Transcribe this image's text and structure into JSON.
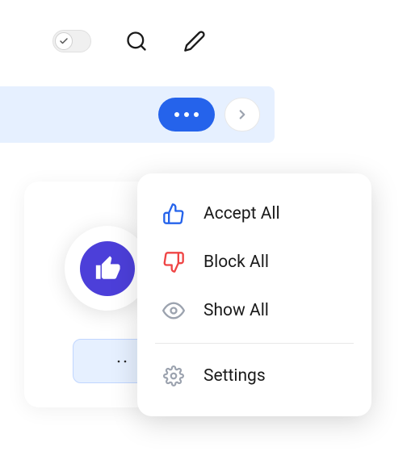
{
  "toolbar": {
    "toggle_state": "on"
  },
  "menu": {
    "items": [
      {
        "label": "Accept All"
      },
      {
        "label": "Block All"
      },
      {
        "label": "Show All"
      }
    ],
    "settings_label": "Settings"
  },
  "colors": {
    "accent": "#2563eb",
    "thumb_bg": "#4c3fd9",
    "accept_icon": "#2563eb",
    "block_icon": "#ef4444",
    "muted_icon": "#9ca3af"
  }
}
